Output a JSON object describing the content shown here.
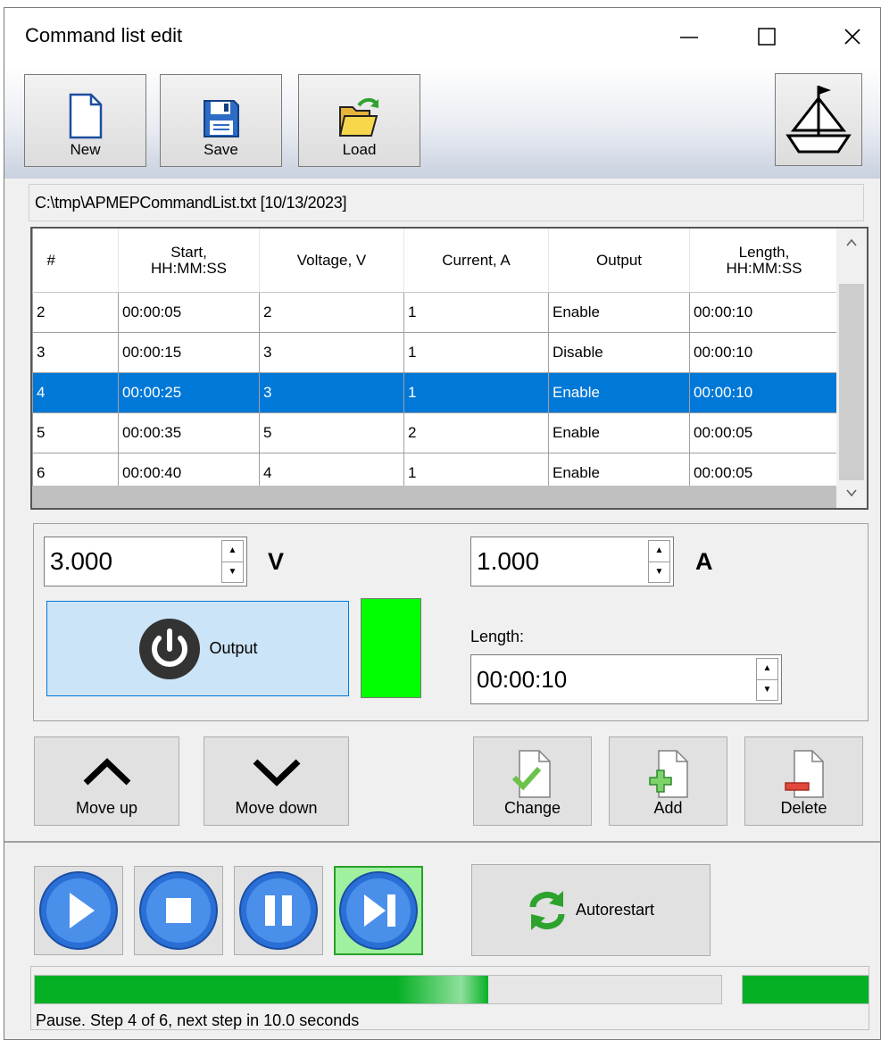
{
  "window": {
    "title": "Command list edit"
  },
  "toolbar": {
    "new_label": "New",
    "save_label": "Save",
    "load_label": "Load"
  },
  "file": {
    "path_display": "C:\\tmp\\APMEPCommandList.txt [10/13/2023]"
  },
  "table": {
    "headers": [
      "#",
      "Start,\nHH:MM:SS",
      "Voltage, V",
      "Current, A",
      "Output",
      "Length,\nHH:MM:SS"
    ],
    "rows": [
      [
        "2",
        "00:00:05",
        "2",
        "1",
        "Enable",
        "00:00:10"
      ],
      [
        "3",
        "00:00:15",
        "3",
        "1",
        "Disable",
        "00:00:10"
      ],
      [
        "4",
        "00:00:25",
        "3",
        "1",
        "Enable",
        "00:00:10"
      ],
      [
        "5",
        "00:00:35",
        "5",
        "2",
        "Enable",
        "00:00:05"
      ],
      [
        "6",
        "00:00:40",
        "4",
        "1",
        "Enable",
        "00:00:05"
      ]
    ],
    "selected_row_index": 2
  },
  "edit": {
    "voltage_value": "3.000",
    "voltage_unit": "V",
    "current_value": "1.000",
    "current_unit": "A",
    "output_label": "Output",
    "output_indicator_color": "#00ff00",
    "length_label": "Length:",
    "length_value": "00:00:10"
  },
  "actions": {
    "move_up_label": "Move up",
    "move_down_label": "Move down",
    "change_label": "Change",
    "add_label": "Add",
    "delete_label": "Delete"
  },
  "player": {
    "autorestart_label": "Autorestart",
    "active_button": "next-step"
  },
  "progress": {
    "main_fraction": 0.66,
    "secondary_fraction": 1.0,
    "status_text": "Pause. Step 4 of 6, next step in 10.0 seconds"
  },
  "colors": {
    "selection": "#0078d7",
    "progress_green": "#06b025",
    "output_button_bg": "#cce4f7"
  }
}
